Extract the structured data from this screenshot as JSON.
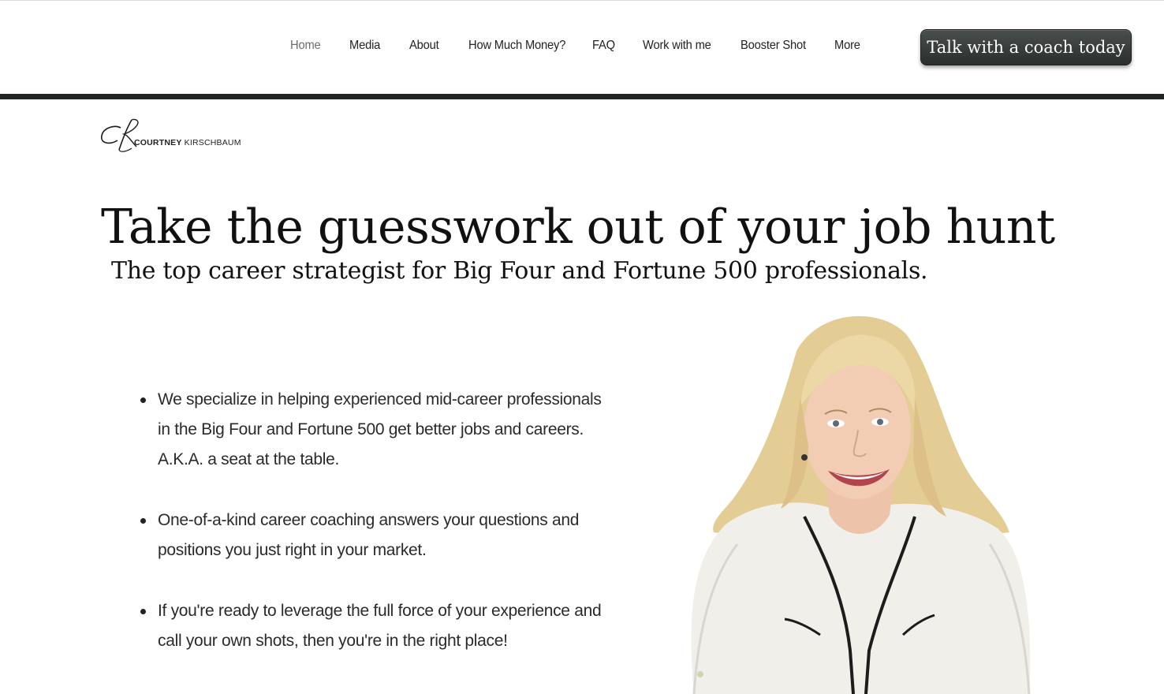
{
  "nav": {
    "items": [
      {
        "label": "Home",
        "active": true
      },
      {
        "label": "Media",
        "active": false
      },
      {
        "label": "About",
        "active": false
      },
      {
        "label": "How Much Money?",
        "active": false
      },
      {
        "label": "FAQ",
        "active": false
      },
      {
        "label": "Work with me",
        "active": false
      },
      {
        "label": "Booster Shot",
        "active": false
      },
      {
        "label": "More",
        "active": false
      }
    ],
    "cta_label": "Talk with a coach today"
  },
  "logo": {
    "monogram": "CK",
    "first_name": "COURTNEY",
    "last_name": "KIRSCHBAUM"
  },
  "hero": {
    "headline": "Take the guesswork out of your job hunt",
    "subheadline": "The top career strategist for Big Four and Fortune 500 professionals."
  },
  "bullets": [
    "We specialize in helping experienced mid-career professionals in the Big Four and Fortune 500 get better jobs and careers. A.K.A. a seat at the table.",
    "One-of-a-kind career coaching answers your questions and positions you just right in your market.",
    "If you're ready to leverage the full force of your experience and call your own shots, then you're in the right place!"
  ],
  "colors": {
    "accent_bar": "#1e2523",
    "cta_bg": "#2f3432",
    "nav_active": "#6b6b6b"
  }
}
